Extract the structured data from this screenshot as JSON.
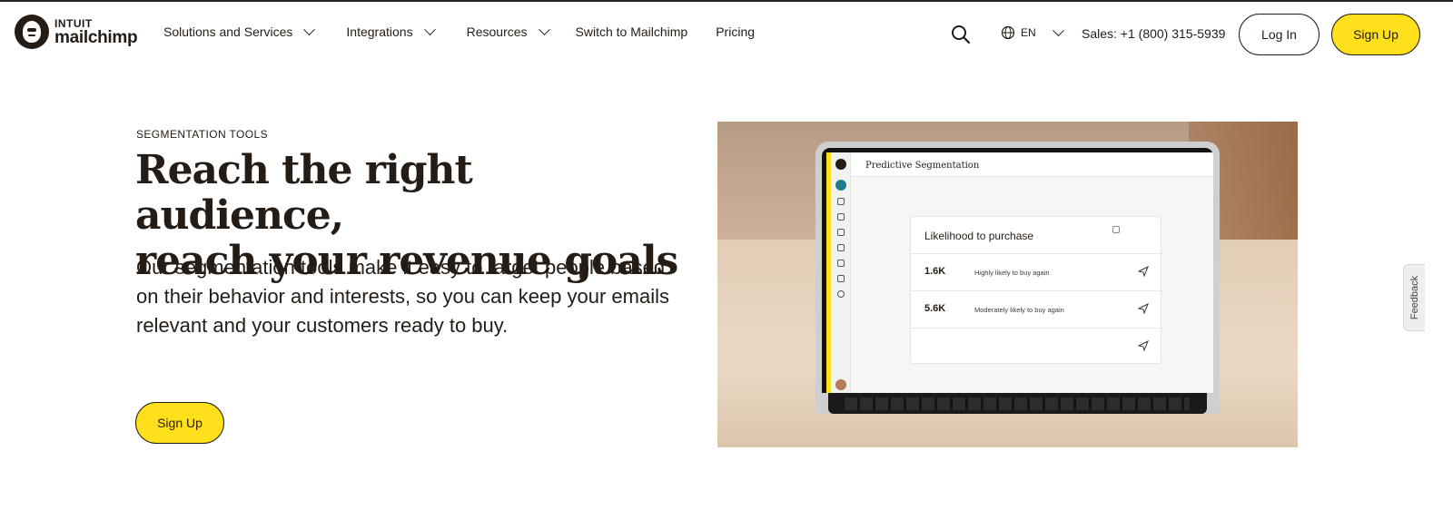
{
  "brand": {
    "intuit": "INTUIT",
    "name": "mailchimp"
  },
  "nav": {
    "items": [
      {
        "label": "Solutions and Services",
        "has_dropdown": true
      },
      {
        "label": "Integrations",
        "has_dropdown": true
      },
      {
        "label": "Resources",
        "has_dropdown": true
      },
      {
        "label": "Switch to Mailchimp",
        "has_dropdown": false
      },
      {
        "label": "Pricing",
        "has_dropdown": false
      }
    ],
    "language": "EN",
    "sales": "Sales: +1 (800) 315-5939",
    "login_label": "Log In",
    "signup_label": "Sign Up"
  },
  "hero": {
    "eyebrow": "SEGMENTATION TOOLS",
    "headline_line1": "Reach the right audience,",
    "headline_line2": "reach your revenue goals",
    "body": "Our segmentation tools make it easy to target people based on their behavior and interests, so you can keep your emails relevant and your customers ready to buy.",
    "cta_label": "Sign Up"
  },
  "screen_app": {
    "title": "Predictive Segmentation",
    "card_title": "Likelihood to purchase",
    "rows": [
      {
        "count": "1.6K",
        "label": "Highly likely to buy again"
      },
      {
        "count": "5.6K",
        "label": "Moderately likely to buy again"
      },
      {
        "count": "",
        "label": ""
      }
    ]
  },
  "feedback_label": "Feedback",
  "colors": {
    "accent_yellow": "#ffe01b",
    "text_dark": "#241c15",
    "teal": "#1f7d8c"
  }
}
